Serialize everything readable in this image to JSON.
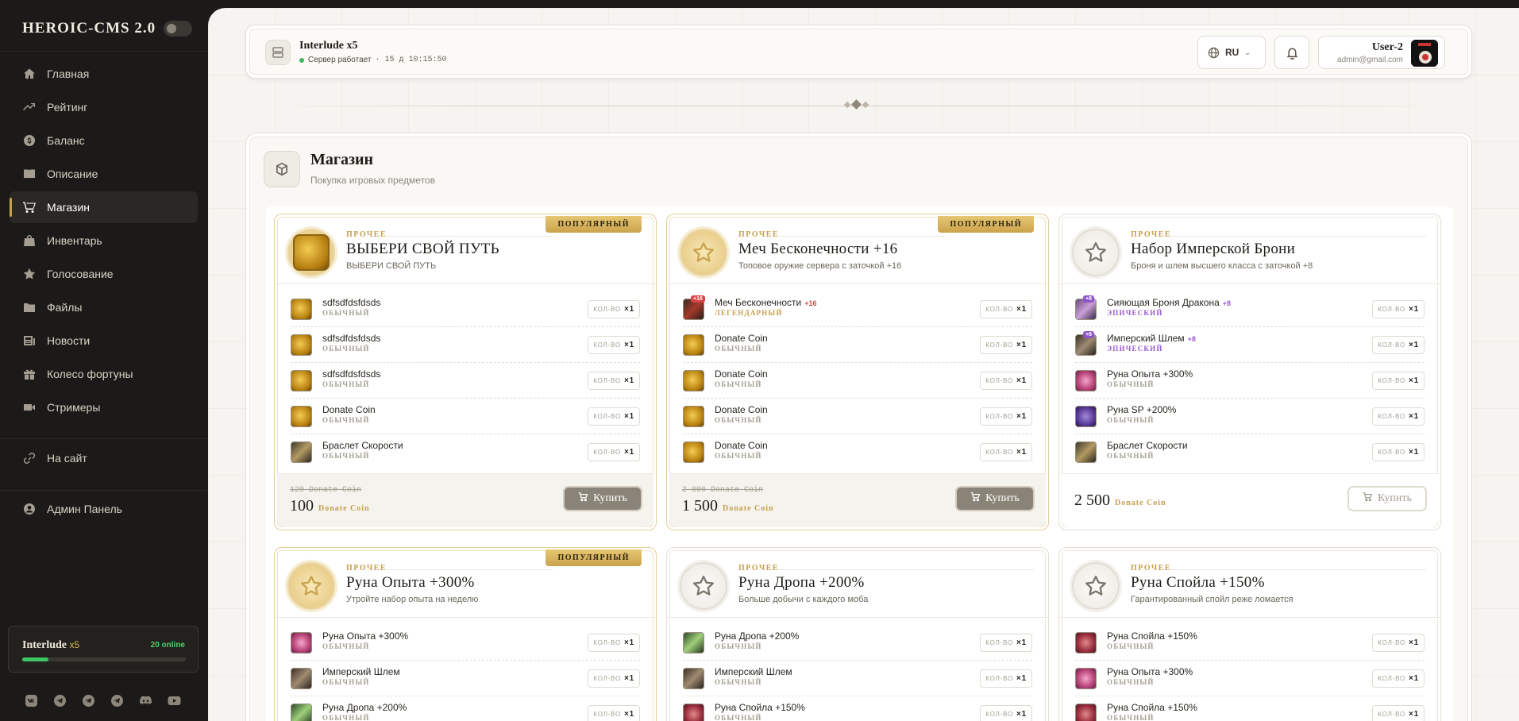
{
  "app": {
    "title": "HEROIC-CMS 2.0"
  },
  "nav": [
    {
      "label": "Главная",
      "icon": "home-icon"
    },
    {
      "label": "Рейтинг",
      "icon": "trend-icon"
    },
    {
      "label": "Баланс",
      "icon": "dollar-icon"
    },
    {
      "label": "Описание",
      "icon": "book-icon"
    },
    {
      "label": "Магазин",
      "icon": "cart-icon",
      "active": true
    },
    {
      "label": "Инвентарь",
      "icon": "bag-icon"
    },
    {
      "label": "Голосование",
      "icon": "star-icon"
    },
    {
      "label": "Файлы",
      "icon": "folder-icon"
    },
    {
      "label": "Новости",
      "icon": "news-icon"
    },
    {
      "label": "Колесо фортуны",
      "icon": "gift-icon"
    },
    {
      "label": "Стримеры",
      "icon": "camera-icon"
    }
  ],
  "nav_extra": [
    {
      "label": "На сайт",
      "icon": "link-icon"
    },
    {
      "label": "Админ Панель",
      "icon": "user-circle-icon"
    }
  ],
  "server_box": {
    "name": "Interlude",
    "rate": "x5",
    "online": "20 online",
    "progress": 0.16
  },
  "socials": [
    "vk-icon",
    "telegram-icon",
    "telegram-icon",
    "telegram-icon",
    "discord-icon",
    "youtube-icon"
  ],
  "topbar": {
    "server_title": "Interlude x5",
    "status": "Сервер работает",
    "uptime": "· 15 д 10:15:50",
    "lang": "RU",
    "user_name": "User-2",
    "user_email": "admin@gmail.com"
  },
  "shop": {
    "title": "Магазин",
    "subtitle": "Покупка игровых предметов"
  },
  "qty_label": "КОЛ-ВО",
  "buy_label": "Купить",
  "currency": "Donate Coin",
  "cards": [
    {
      "category": "ПРОЧЕЕ",
      "badge": "ПОПУЛЯРНЫЙ",
      "title": "ВЫБЕРИ СВОЙ ПУТЬ",
      "desc": "ВЫБЕРИ СВОЙ ПУТЬ",
      "icon": "coin-icon",
      "items": [
        {
          "name": "sdfsdfdsfdsds",
          "rarity": "ОБЫЧНЫЙ",
          "qty": "×1",
          "thumb": "coin"
        },
        {
          "name": "sdfsdfdsfdsds",
          "rarity": "ОБЫЧНЫЙ",
          "qty": "×1",
          "thumb": "coin"
        },
        {
          "name": "sdfsdfdsfdsds",
          "rarity": "ОБЫЧНЫЙ",
          "qty": "×1",
          "thumb": "coin"
        },
        {
          "name": "Donate Coin",
          "rarity": "ОБЫЧНЫЙ",
          "qty": "×1",
          "thumb": "coin"
        },
        {
          "name": "Браслет Скорости",
          "rarity": "ОБЫЧНЫЙ",
          "qty": "×1",
          "thumb": "brace"
        }
      ],
      "old_price": "120 Donate Coin",
      "price": "100"
    },
    {
      "category": "ПРОЧЕЕ",
      "badge": "ПОПУЛЯРНЫЙ",
      "title": "Меч Бесконечности +16",
      "desc": "Топовое оружие сервера с заточкой +16",
      "icon": "star-icon",
      "items": [
        {
          "name": "Меч Бесконечности",
          "plus": "+16",
          "rarity": "ЛЕГЕНДАРНЫЙ",
          "qty": "×1",
          "thumb": "sword",
          "ench": "+16",
          "ench_color": "red"
        },
        {
          "name": "Donate Coin",
          "rarity": "ОБЫЧНЫЙ",
          "qty": "×1",
          "thumb": "coin"
        },
        {
          "name": "Donate Coin",
          "rarity": "ОБЫЧНЫЙ",
          "qty": "×1",
          "thumb": "coin"
        },
        {
          "name": "Donate Coin",
          "rarity": "ОБЫЧНЫЙ",
          "qty": "×1",
          "thumb": "coin"
        },
        {
          "name": "Donate Coin",
          "rarity": "ОБЫЧНЫЙ",
          "qty": "×1",
          "thumb": "coin"
        }
      ],
      "old_price": "2 000 Donate Coin",
      "price": "1 500"
    },
    {
      "category": "ПРОЧЕЕ",
      "badge": "",
      "title": "Набор Имперской Брони",
      "desc": "Броня и шлем высшего класса с заточкой +8",
      "icon": "star-icon",
      "items": [
        {
          "name": "Сияющая Броня Дракона",
          "plus": "+8",
          "rarity": "ЭПИЧЕСКИЙ",
          "qty": "×1",
          "thumb": "armor",
          "ench": "+8",
          "ench_color": "purple"
        },
        {
          "name": "Имперский Шлем",
          "plus": "+8",
          "rarity": "ЭПИЧЕСКИЙ",
          "qty": "×1",
          "thumb": "helm",
          "ench": "+8",
          "ench_color": "purple"
        },
        {
          "name": "Руна Опыта +300%",
          "rarity": "ОБЫЧНЫЙ",
          "qty": "×1",
          "thumb": "runexp"
        },
        {
          "name": "Руна SP +200%",
          "rarity": "ОБЫЧНЫЙ",
          "qty": "×1",
          "thumb": "runesp"
        },
        {
          "name": "Браслет Скорости",
          "rarity": "ОБЫЧНЫЙ",
          "qty": "×1",
          "thumb": "brace"
        }
      ],
      "old_price": "",
      "price": "2 500"
    },
    {
      "category": "ПРОЧЕЕ",
      "badge": "ПОПУЛЯРНЫЙ",
      "title": "Руна Опыта +300%",
      "desc": "Утройте набор опыта на неделю",
      "icon": "star-icon",
      "items": [
        {
          "name": "Руна Опыта +300%",
          "rarity": "ОБЫЧНЫЙ",
          "qty": "×1",
          "thumb": "runexp"
        },
        {
          "name": "Имперский Шлем",
          "rarity": "ОБЫЧНЫЙ",
          "qty": "×1",
          "thumb": "helm"
        },
        {
          "name": "Руна Дропа +200%",
          "rarity": "ОБЫЧНЫЙ",
          "qty": "×1",
          "thumb": "runedrop"
        }
      ]
    },
    {
      "category": "ПРОЧЕЕ",
      "badge": "",
      "title": "Руна Дропа +200%",
      "desc": "Больше добычи с каждого моба",
      "icon": "star-icon",
      "items": [
        {
          "name": "Руна Дропа +200%",
          "rarity": "ОБЫЧНЫЙ",
          "qty": "×1",
          "thumb": "runedrop"
        },
        {
          "name": "Имперский Шлем",
          "rarity": "ОБЫЧНЫЙ",
          "qty": "×1",
          "thumb": "helm"
        },
        {
          "name": "Руна Спойла +150%",
          "rarity": "ОБЫЧНЫЙ",
          "qty": "×1",
          "thumb": "runespoil"
        }
      ]
    },
    {
      "category": "ПРОЧЕЕ",
      "badge": "",
      "title": "Руна Спойла +150%",
      "desc": "Гарантированный спойл реже ломается",
      "icon": "star-icon",
      "items": [
        {
          "name": "Руна Спойла +150%",
          "rarity": "ОБЫЧНЫЙ",
          "qty": "×1",
          "thumb": "runespoil"
        },
        {
          "name": "Руна Опыта +300%",
          "rarity": "ОБЫЧНЫЙ",
          "qty": "×1",
          "thumb": "runexp"
        },
        {
          "name": "Руна Спойла +150%",
          "rarity": "ОБЫЧНЫЙ",
          "qty": "×1",
          "thumb": "runespoil"
        }
      ]
    }
  ]
}
